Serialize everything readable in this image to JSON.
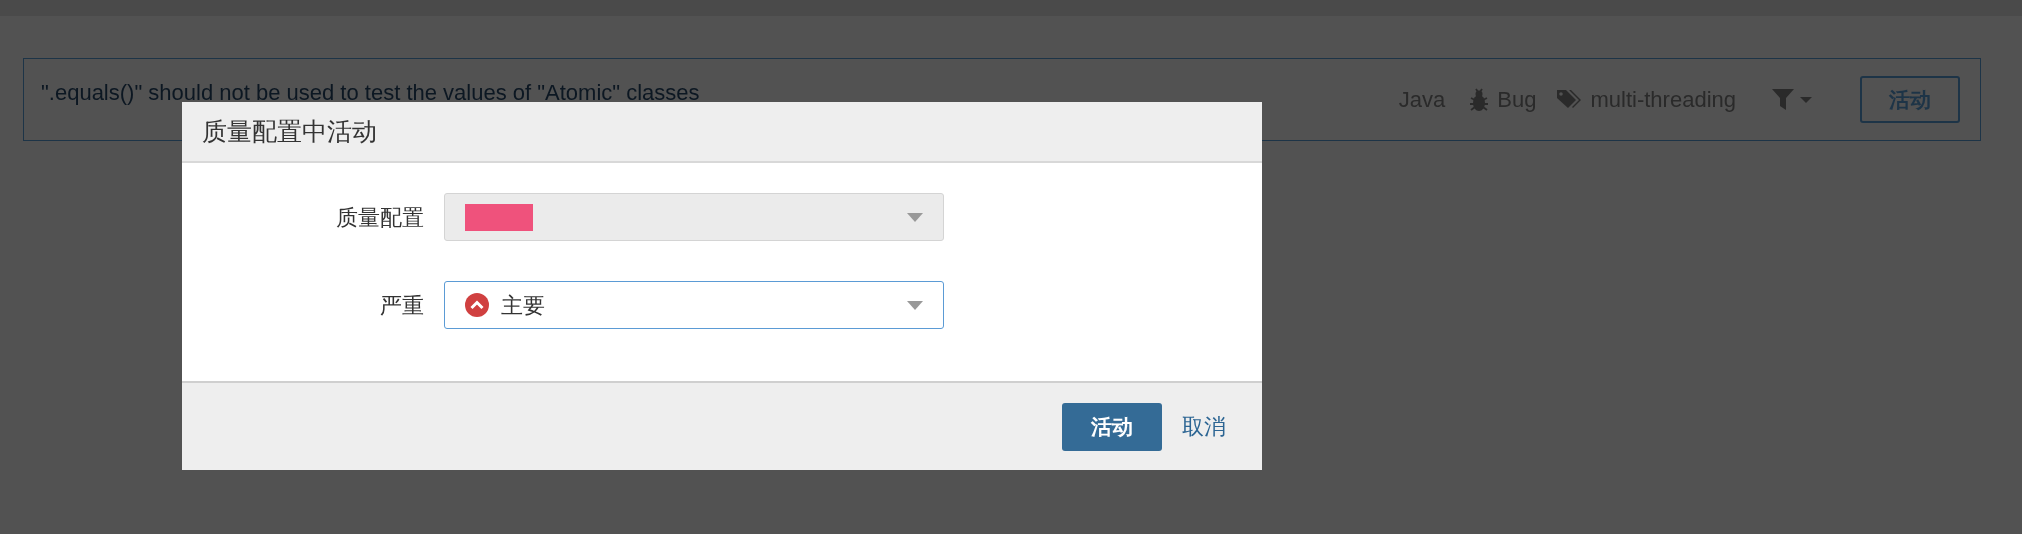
{
  "rule": {
    "title": "\".equals()\" should not be used to test the values of \"Atomic\" classes",
    "language": "Java",
    "type": "Bug",
    "tags": "multi-threading",
    "activate_button": "活动"
  },
  "dialog": {
    "title": "质量配置中活动",
    "fields": [
      {
        "label": "质量配置",
        "kind": "select",
        "disabled": true,
        "redacted": true
      },
      {
        "label": "严重",
        "kind": "select",
        "disabled": false,
        "value": "主要"
      }
    ],
    "buttons": [
      {
        "label": "活动",
        "kind": "primary"
      },
      {
        "label": "取消",
        "kind": "link"
      }
    ]
  }
}
